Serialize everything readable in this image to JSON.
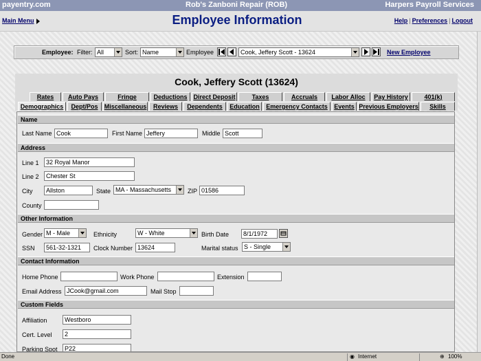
{
  "header": {
    "brand": "payentry.com",
    "company": "Rob's Zanboni Repair (ROB)",
    "product": "Harpers Payroll Services"
  },
  "titlebar": {
    "main_menu": "Main Menu",
    "title": "Employee Information",
    "links": [
      "Help",
      "Preferences",
      "Logout"
    ]
  },
  "employee_bar": {
    "employee_label": "Employee:",
    "filter_label": "Filter:",
    "filter_value": "All",
    "sort_label": "Sort:",
    "sort_value": "Name",
    "employee_field_label": "Employee",
    "employee_value": "Cook, Jeffery Scott - 13624",
    "new_employee": "New Employee"
  },
  "employee_name": "Cook, Jeffery Scott (13624)",
  "tabs_row1": [
    "Rates",
    "Auto Pays",
    "Fringe",
    "Deductions",
    "Direct Deposit",
    "Taxes",
    "Accruals",
    "Labor Alloc",
    "Pay History",
    "401(k)"
  ],
  "tabs_row2": [
    "Demographics",
    "Dept/Pos",
    "Miscellaneous",
    "Reviews",
    "Dependents",
    "Education",
    "Emergency Contacts",
    "Events",
    "Previous Employers",
    "Skills"
  ],
  "active_tab": "Demographics",
  "sections": {
    "name": {
      "title": "Name",
      "last_name_label": "Last Name",
      "last_name": "Cook",
      "first_name_label": "First Name",
      "first_name": "Jeffery",
      "middle_label": "Middle",
      "middle": "Scott"
    },
    "address": {
      "title": "Address",
      "line1_label": "Line 1",
      "line1": "32 Royal Manor",
      "line2_label": "Line 2",
      "line2": "Chester St",
      "city_label": "City",
      "city": "Allston",
      "state_label": "State",
      "state": "MA - Massachusetts",
      "zip_label": "ZIP",
      "zip": "01586",
      "county_label": "County",
      "county": ""
    },
    "other": {
      "title": "Other Information",
      "gender_label": "Gender",
      "gender": "M - Male",
      "ethnicity_label": "Ethnicity",
      "ethnicity": "W - White",
      "birth_label": "Birth Date",
      "birth": "8/1/1972",
      "ssn_label": "SSN",
      "ssn": "561-32-1321",
      "clock_label": "Clock Number",
      "clock": "13624",
      "marital_label": "Marital status",
      "marital": "S - Single"
    },
    "contact": {
      "title": "Contact Information",
      "home_label": "Home Phone",
      "home": "",
      "work_label": "Work Phone",
      "work": "",
      "ext_label": "Extension",
      "ext": "",
      "email_label": "Email Address",
      "email": "JCook@gmail.com",
      "mailstop_label": "Mail Stop",
      "mailstop": ""
    },
    "custom": {
      "title": "Custom Fields",
      "affiliation_label": "Affiliation",
      "affiliation": "Westboro",
      "cert_label": "Cert. Level",
      "cert": "2",
      "parking_label": "Parking Spot",
      "parking": "P22"
    }
  },
  "statusbar": {
    "left": "Done",
    "zone": "Internet",
    "zoom": "100%"
  },
  "colors": {
    "topbar": "#8c96b4",
    "title": "#0a1d82",
    "section_header": "#c6c6c6"
  }
}
